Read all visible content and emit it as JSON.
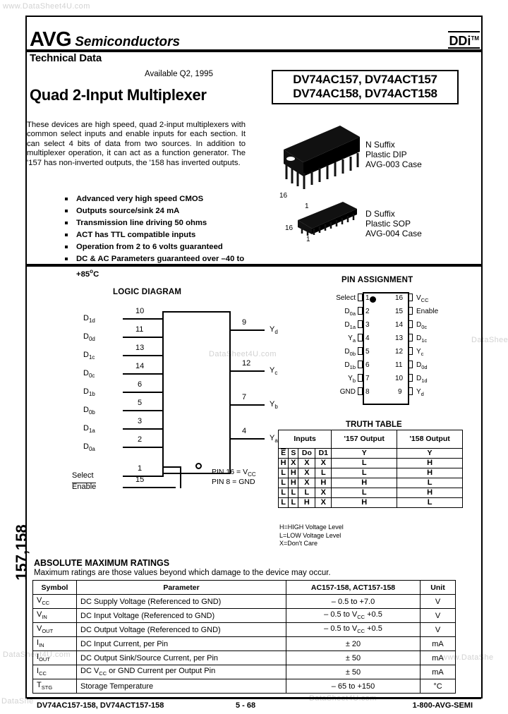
{
  "watermarks": {
    "top": "www.DataSheet4U.com",
    "mid_center": "DataSheet4U.com",
    "mid_right": "DataShee",
    "low_left": "DataSheet4U.com",
    "low_right": "www.DataShe",
    "bottom_left": "DataShe",
    "bottom_center": "DataSheet4U.com"
  },
  "header": {
    "brand_primary": "AVG",
    "brand_secondary": "Semiconductors",
    "subtitle": "Technical Data",
    "logo_right": "DDi",
    "logo_right_tm": "TM",
    "availability": "Available Q2, 1995",
    "title": "Quad 2-Input Multiplexer",
    "part_numbers": [
      "DV74AC157, DV74ACT157",
      "DV74AC158, DV74ACT158"
    ]
  },
  "description": "These devices are high speed, quad 2-input multiplexers with common select inputs and enable inputs for each section. It can select 4 bits of data from two sources.  In addition to multiplexer operation, it can act as a function generator.  The '157 has non-inverted outputs, the '158 has inverted outputs.",
  "features": [
    "Advanced very high speed CMOS",
    "Outputs source/sink 24 mA",
    "Transmission line driving 50 ohms",
    "ACT has TTL compatible inputs",
    "Operation from 2 to 6 volts guaranteed",
    "DC & AC Parameters guaranteed over –40 to +85"
  ],
  "feature_last_unit": "C",
  "packages": [
    {
      "suffix": "N Suffix",
      "type": "Plastic DIP",
      "case": "AVG-003 Case",
      "pin_hi": "16",
      "pin_lo": "1"
    },
    {
      "suffix": "D Suffix",
      "type": "Plastic SOP",
      "case": "AVG-004 Case",
      "pin_hi": "16",
      "pin_lo": "1"
    }
  ],
  "logic_diagram": {
    "title": "LOGIC DIAGRAM",
    "inputs": [
      {
        "label": "D",
        "sub": "1d",
        "pin": "10"
      },
      {
        "label": "D",
        "sub": "0d",
        "pin": "11"
      },
      {
        "label": "D",
        "sub": "1c",
        "pin": "13"
      },
      {
        "label": "D",
        "sub": "0c",
        "pin": "14"
      },
      {
        "label": "D",
        "sub": "1b",
        "pin": "6"
      },
      {
        "label": "D",
        "sub": "0b",
        "pin": "5"
      },
      {
        "label": "D",
        "sub": "1a",
        "pin": "3"
      },
      {
        "label": "D",
        "sub": "0a",
        "pin": "2"
      }
    ],
    "controls": [
      {
        "label": "Select",
        "pin": "1",
        "overline": false
      },
      {
        "label": "Enable",
        "pin": "15",
        "overline": true
      }
    ],
    "outputs": [
      {
        "label": "Y",
        "sub": "d",
        "pin": "9"
      },
      {
        "label": "Y",
        "sub": "c",
        "pin": "12"
      },
      {
        "label": "Y",
        "sub": "b",
        "pin": "7"
      },
      {
        "label": "Y",
        "sub": "a",
        "pin": "4"
      }
    ],
    "notes": [
      {
        "text": "PIN 16  =  V",
        "sub": "CC"
      },
      {
        "text": "PIN  8  =  GND",
        "sub": ""
      }
    ]
  },
  "pin_assignment": {
    "title": "PIN ASSIGNMENT",
    "left": [
      {
        "name": "Select",
        "sub": "",
        "pin": "1"
      },
      {
        "name": "D",
        "sub": "0a",
        "pin": "2"
      },
      {
        "name": "D",
        "sub": "1a",
        "pin": "3"
      },
      {
        "name": "Y",
        "sub": "a",
        "pin": "4"
      },
      {
        "name": "D",
        "sub": "0b",
        "pin": "5"
      },
      {
        "name": "D",
        "sub": "1b",
        "pin": "6"
      },
      {
        "name": "Y",
        "sub": "b",
        "pin": "7"
      },
      {
        "name": "GND",
        "sub": "",
        "pin": "8"
      }
    ],
    "right": [
      {
        "name": "V",
        "sub": "CC",
        "pin": "16"
      },
      {
        "name": "Enable",
        "sub": "",
        "pin": "15"
      },
      {
        "name": "D",
        "sub": "0c",
        "pin": "14"
      },
      {
        "name": "D",
        "sub": "1c",
        "pin": "13"
      },
      {
        "name": "Y",
        "sub": "c",
        "pin": "12"
      },
      {
        "name": "D",
        "sub": "0d",
        "pin": "11"
      },
      {
        "name": "D",
        "sub": "1d",
        "pin": "10"
      },
      {
        "name": "Y",
        "sub": "d",
        "pin": "9"
      }
    ]
  },
  "truth_table": {
    "title": "TRUTH TABLE",
    "group_headers": {
      "inputs": "Inputs",
      "out157": "'157 Output",
      "out158": "'158 Output"
    },
    "columns": [
      "E",
      "S",
      "Do",
      "D1",
      "Y",
      "Y"
    ],
    "rows": [
      [
        "H",
        "X",
        "X",
        "X",
        "L",
        "H"
      ],
      [
        "L",
        "H",
        "X",
        "L",
        "L",
        "H"
      ],
      [
        "L",
        "H",
        "X",
        "H",
        "H",
        "L"
      ],
      [
        "L",
        "L",
        "L",
        "X",
        "L",
        "H"
      ],
      [
        "L",
        "L",
        "H",
        "X",
        "H",
        "L"
      ]
    ],
    "legend": [
      "H=HIGH Voltage Level",
      "L=LOW Voltage Level",
      "X=Don't Care"
    ]
  },
  "side_tab": "157,158",
  "abs_max": {
    "title": "ABSOLUTE MAXIMUM RATINGS",
    "subtitle": "Maximum ratings are those values beyond which damage to the device may occur.",
    "headers": [
      "Symbol",
      "Parameter",
      "AC157-158, ACT157-158",
      "Unit"
    ],
    "rows": [
      {
        "sym": "V",
        "sub": "CC",
        "param": "DC Supply Voltage (Referenced to GND)",
        "value": "– 0.5 to +7.0",
        "unit": "V"
      },
      {
        "sym": "V",
        "sub": "IN",
        "param": "DC Input Voltage (Referenced to GND)",
        "value": "– 0.5 to V_CC +0.5",
        "unit": "V"
      },
      {
        "sym": "V",
        "sub": "OUT",
        "param": "DC Output Voltage (Referenced to GND)",
        "value": "– 0.5 to V_CC +0.5",
        "unit": "V"
      },
      {
        "sym": "I",
        "sub": "IN",
        "param": "DC Input Current, per Pin",
        "value": "± 20",
        "unit": "mA"
      },
      {
        "sym": "I",
        "sub": "OUT",
        "param": "DC Output Sink/Source Current, per Pin",
        "value": "± 50",
        "unit": "mA"
      },
      {
        "sym": "I",
        "sub": "CC",
        "param": "DC V_CC or GND Current per Output Pin",
        "value": "± 50",
        "unit": "mA"
      },
      {
        "sym": "T",
        "sub": "STG",
        "param": "Storage Temperature",
        "value": "– 65 to  +150",
        "unit": "°C"
      }
    ]
  },
  "footer": {
    "left": "DV74AC157-158, DV74ACT157-158",
    "center": "5 - 68",
    "right": "1-800-AVG-SEMI"
  }
}
